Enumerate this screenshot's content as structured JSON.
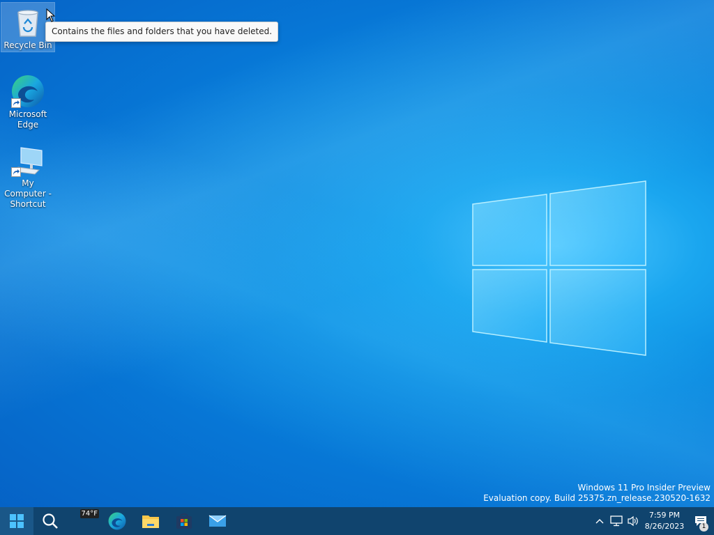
{
  "desktop": {
    "icons": [
      {
        "label": "Recycle Bin",
        "icon": "recycle-bin-icon"
      },
      {
        "label": "Microsoft Edge",
        "icon": "edge-icon"
      },
      {
        "label": "My Computer - Shortcut",
        "icon": "computer-icon"
      }
    ],
    "tooltip": "Contains the files and folders that you have deleted.",
    "watermark": {
      "line1": "Windows 11 Pro Insider Preview",
      "line2": "Evaluation copy. Build 25375.zn_release.230520-1632"
    }
  },
  "taskbar": {
    "items": [
      {
        "name": "Start",
        "icon": "windows-start-icon"
      },
      {
        "name": "Search",
        "icon": "search-icon"
      },
      {
        "name": "Weather",
        "icon": "weather-icon",
        "badge": "74°F"
      },
      {
        "name": "Microsoft Edge",
        "icon": "edge-icon"
      },
      {
        "name": "File Explorer",
        "icon": "folder-icon"
      },
      {
        "name": "Microsoft Store",
        "icon": "store-icon"
      },
      {
        "name": "Mail",
        "icon": "mail-icon"
      }
    ],
    "tray": {
      "time": "7:59 PM",
      "date": "8/26/2023",
      "notification_count": "1",
      "icons": [
        "chevron-up-icon",
        "network-icon",
        "volume-icon",
        "notification-icon"
      ]
    }
  },
  "colors": {
    "taskbar": "#10446e",
    "desktop_blue": "#0a8ae0"
  }
}
